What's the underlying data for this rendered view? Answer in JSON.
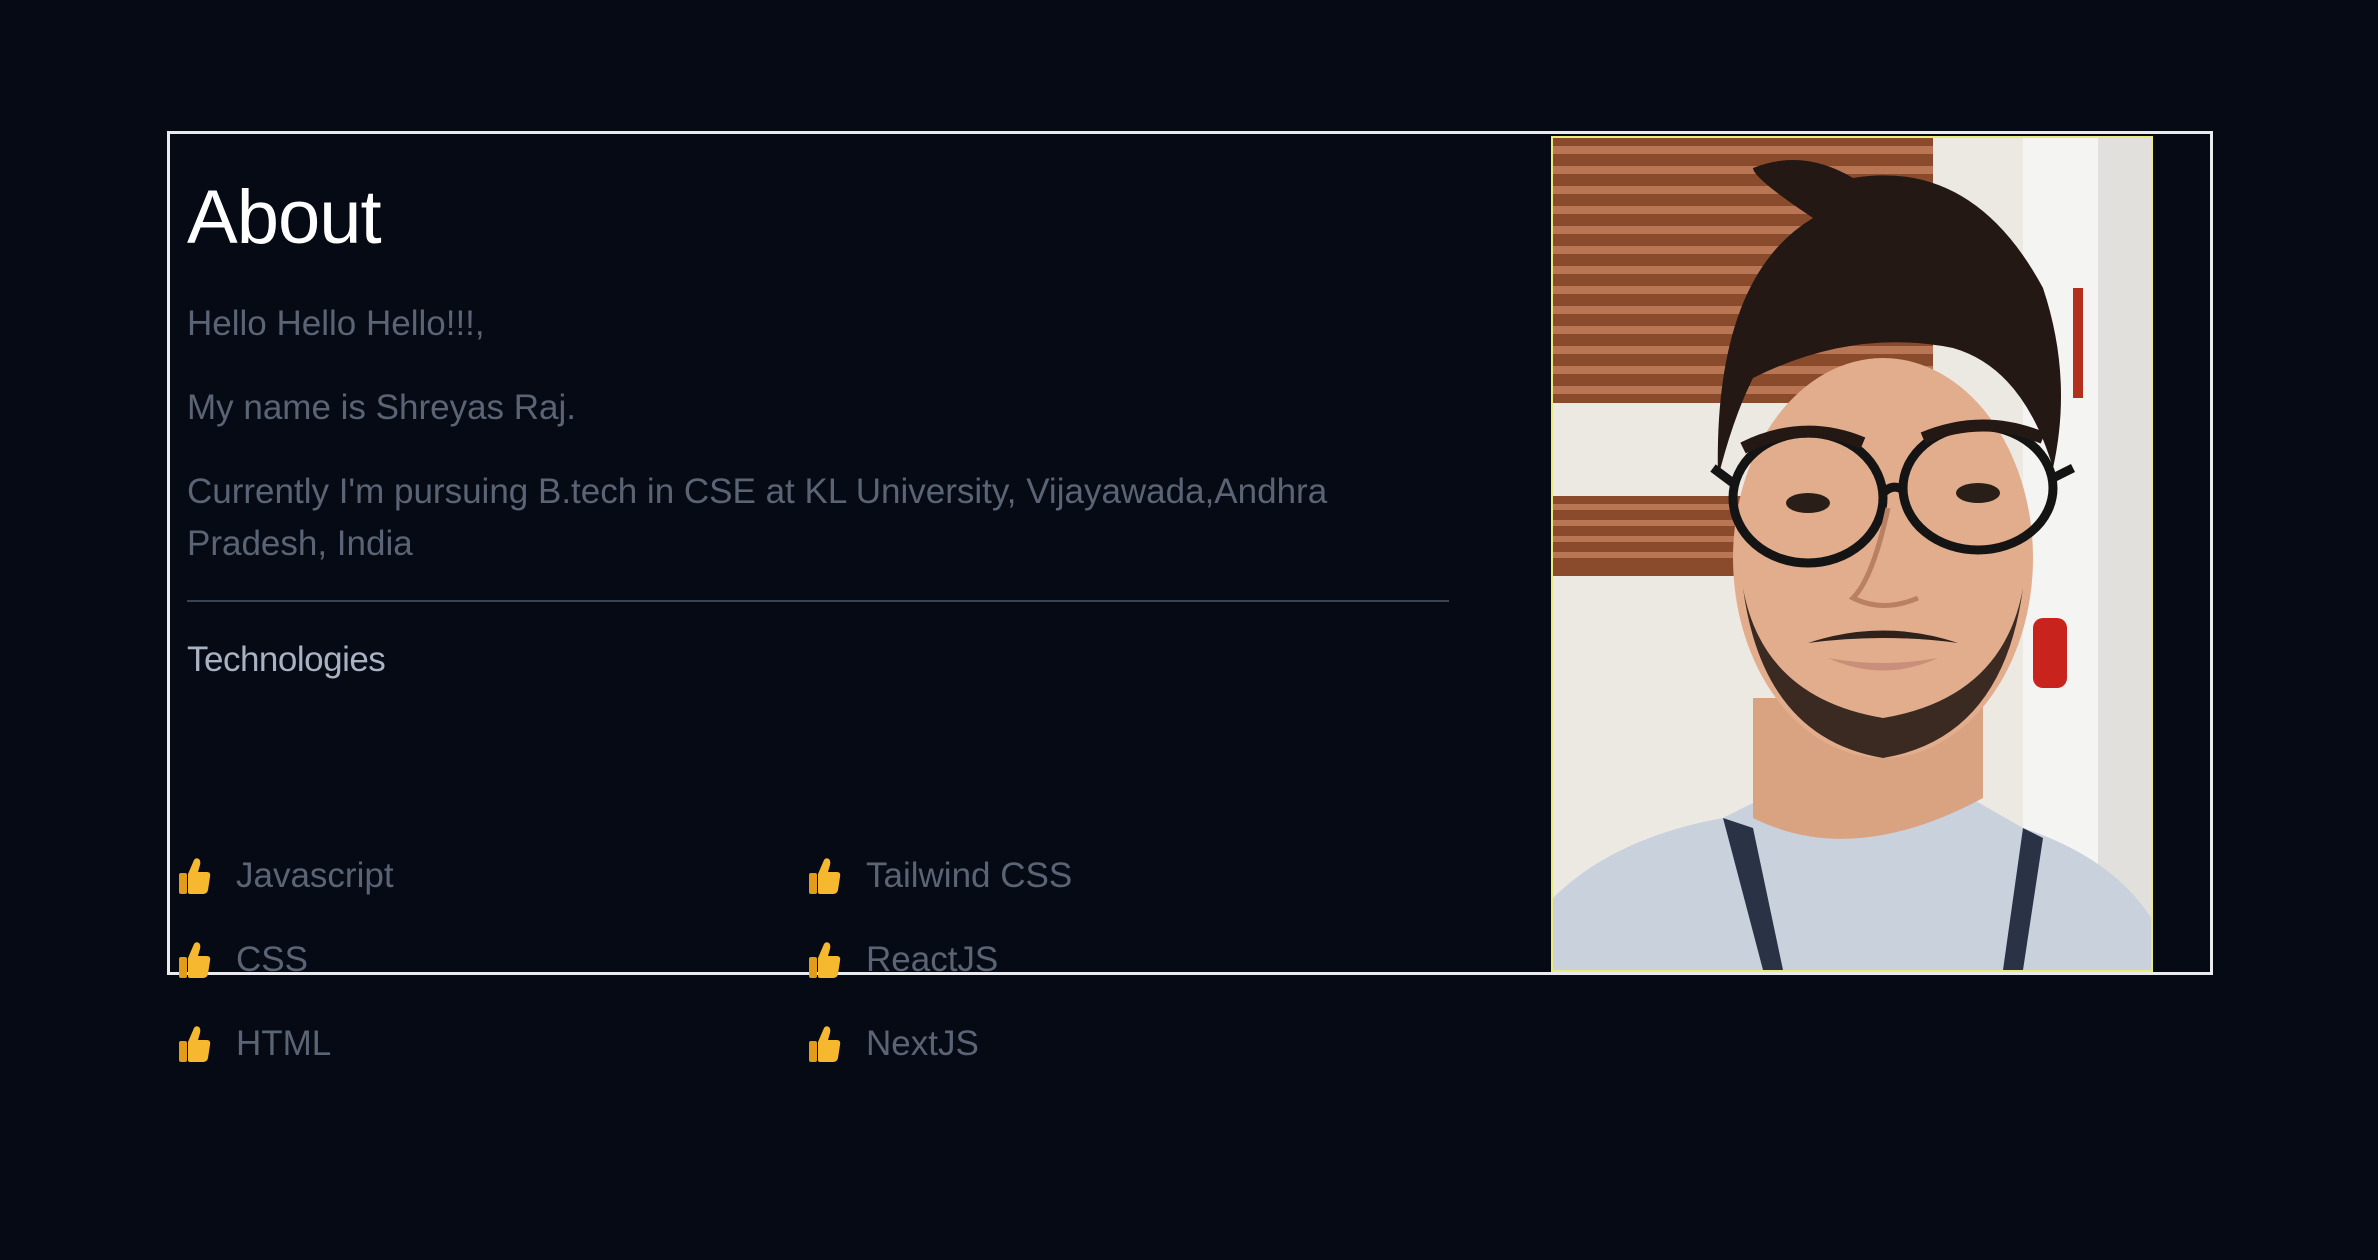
{
  "about": {
    "title": "About",
    "paragraphs": [
      "Hello Hello Hello!!!,",
      "My name is Shreyas Raj.",
      "Currently I'm pursuing B.tech in CSE at KL University, Vijayawada,Andhra Pradesh, India"
    ],
    "technologies_title": "Technologies",
    "technologies": [
      {
        "label": "Javascript",
        "icon": "thumbs-up-icon"
      },
      {
        "label": "Tailwind CSS",
        "icon": "thumbs-up-icon"
      },
      {
        "label": "CSS",
        "icon": "thumbs-up-icon"
      },
      {
        "label": "ReactJS",
        "icon": "thumbs-up-icon"
      },
      {
        "label": "HTML",
        "icon": "thumbs-up-icon"
      },
      {
        "label": "NextJS",
        "icon": "thumbs-up-icon"
      }
    ]
  },
  "colors": {
    "background": "#060a14",
    "card_border": "#e9ebef",
    "title": "#ffffff",
    "body_text": "#5a6474",
    "tech_heading": "#a8b2c2",
    "photo_border": "#e8ec7a",
    "thumb": "#f5b82e"
  }
}
